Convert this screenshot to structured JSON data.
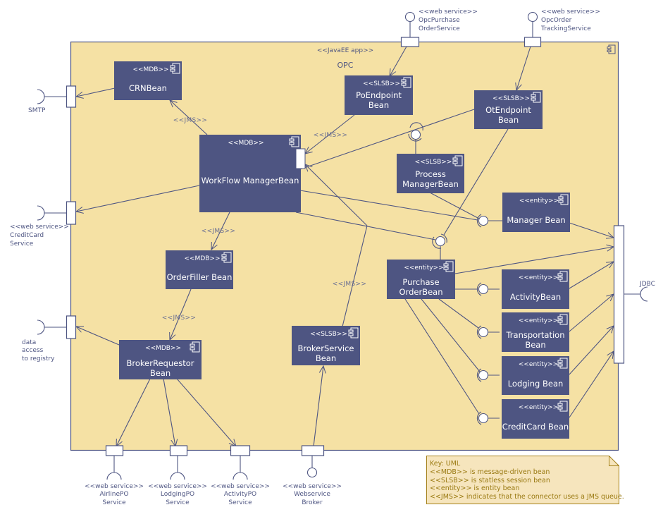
{
  "container": {
    "stereotype": "<<JavaEE app>>",
    "name": "OPC",
    "icon": "component-icon",
    "fill": "#f5e1a4",
    "stroke": "#4e5582"
  },
  "colors": {
    "bean_fill": "#4e5582",
    "bean_text": "#ffffff",
    "connector": "#4e5582",
    "note_fill": "#f6e5bd",
    "note_border": "#a5821c",
    "note_text": "#9a7a12"
  },
  "beans": [
    {
      "id": "crn",
      "stereotype": "<<MDB>>",
      "name": [
        "CRNBean"
      ]
    },
    {
      "id": "poendpoint",
      "stereotype": "<<SLSB>>",
      "name": [
        "PoEndpoint",
        "Bean"
      ]
    },
    {
      "id": "otendpoint",
      "stereotype": "<<SLSB>>",
      "name": [
        "OtEndpoint",
        "Bean"
      ]
    },
    {
      "id": "workflow",
      "stereotype": "<<MDB>>",
      "name": [
        "WorkFlow ManagerBean"
      ]
    },
    {
      "id": "processmgr",
      "stereotype": "<<SLSB>>",
      "name": [
        "Process",
        "ManagerBean"
      ]
    },
    {
      "id": "manager",
      "stereotype": "<<entity>>",
      "name": [
        "Manager Bean"
      ]
    },
    {
      "id": "orderfiller",
      "stereotype": "<<MDB>>",
      "name": [
        "OrderFiller Bean"
      ]
    },
    {
      "id": "purchaseorder",
      "stereotype": "<<entity>>",
      "name": [
        "Purchase",
        "OrderBean"
      ]
    },
    {
      "id": "activity",
      "stereotype": "<<entity>>",
      "name": [
        "ActivityBean"
      ]
    },
    {
      "id": "transportation",
      "stereotype": "<<entity>>",
      "name": [
        "Transportation",
        "Bean"
      ]
    },
    {
      "id": "brokerrequestor",
      "stereotype": "<<MDB>>",
      "name": [
        "BrokerRequestor",
        "Bean"
      ]
    },
    {
      "id": "brokerservice",
      "stereotype": "<<SLSB>>",
      "name": [
        "BrokerService",
        "Bean"
      ]
    },
    {
      "id": "lodging",
      "stereotype": "<<entity>>",
      "name": [
        "Lodging Bean"
      ]
    },
    {
      "id": "creditcard",
      "stereotype": "<<entity>>",
      "name": [
        "CreditCard Bean"
      ]
    }
  ],
  "jms_label": "<<JMS>>",
  "external_interfaces": {
    "opc_purchase": [
      "<<web service>>",
      "OpcPurchase",
      "OrderService"
    ],
    "opc_order_tracking": [
      "<<web service>>",
      "OpcOrder",
      "TrackingService"
    ],
    "smtp": [
      "SMTP"
    ],
    "credit_card_service": [
      "<<web service>>",
      "CreditCard",
      "Service"
    ],
    "registry": [
      "data",
      "access",
      "to registry"
    ],
    "jdbc": [
      "JDBC"
    ],
    "airline_po": [
      "<<web service>>",
      "AirlinePO",
      "Service"
    ],
    "lodging_po": [
      "<<web service>>",
      "LodgingPO",
      "Service"
    ],
    "activity_po": [
      "<<web service>>",
      "ActivityPO",
      "Service"
    ],
    "webservice_broker": [
      "<<web service>>",
      "Webservice",
      "Broker"
    ]
  },
  "note": {
    "lines": [
      "Key: UML",
      "<<MDB>> is message-driven bean",
      "<<SLSB>> is statless session bean",
      "<<entity>> is entity bean",
      "<<JMS>> indicates that the connector uses a JMS queue."
    ]
  }
}
